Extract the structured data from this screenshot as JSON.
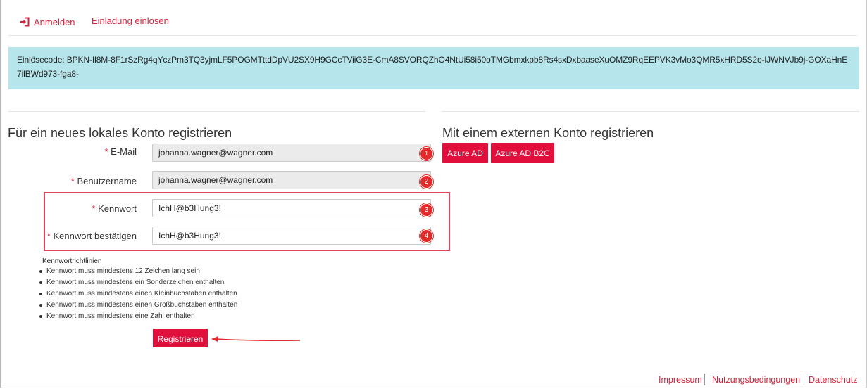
{
  "nav": {
    "login_label": "Anmelden",
    "redeem_label": "Einladung einlösen",
    "login_icon": "sign-in-icon"
  },
  "banner": {
    "text": "Einlösecode: BPKN-Il8M-8F1rSzRg4qYczPm3TQ3yjmLF5POGMTttdDpVU2SX9H9GCcTViiG3E-CmA8SVORQZhO4NtUi58i50oTMGbmxkpb8Rs4sxDxbaaseXuOMZ9RqEEPVK3vMo3QMR5xHRD5S2o-lJWNVJb9j-GOXaHnE7ilBWd973-fga8-"
  },
  "local": {
    "heading": "Für ein neues lokales Konto registrieren",
    "required_mark": "*",
    "fields": [
      {
        "label": "E-Mail",
        "value": "johanna.wagner@wagner.com",
        "badge": "1"
      },
      {
        "label": "Benutzername",
        "value": "johanna.wagner@wagner.com",
        "badge": "2"
      },
      {
        "label": "Kennwort",
        "value": "IchH@b3Hung3!",
        "badge": "3"
      },
      {
        "label": "Kennwort bestätigen",
        "value": "IchH@b3Hung3!",
        "badge": "4"
      }
    ],
    "policy_title": "Kennwortrichtlinien",
    "policies": [
      "Kennwort muss mindestens 12 Zeichen lang sein",
      "Kennwort muss mindestens ein Sonderzeichen enthalten",
      "Kennwort muss mindestens einen Kleinbuchstaben enthalten",
      "Kennwort muss mindestens einen Großbuchstaben enthalten",
      "Kennwort muss mindestens eine Zahl enthalten"
    ],
    "register_label": "Registrieren"
  },
  "external": {
    "heading": "Mit einem externen Konto registrieren",
    "providers": [
      "Azure AD",
      "Azure AD B2C"
    ]
  },
  "footer": {
    "links": [
      "Impressum",
      "Nutzungsbedingungen",
      "Datenschutz"
    ]
  },
  "colors": {
    "accent": "#e00f3c",
    "banner_bg": "#b7e5ec",
    "annotation_red": "#e32b2b"
  }
}
